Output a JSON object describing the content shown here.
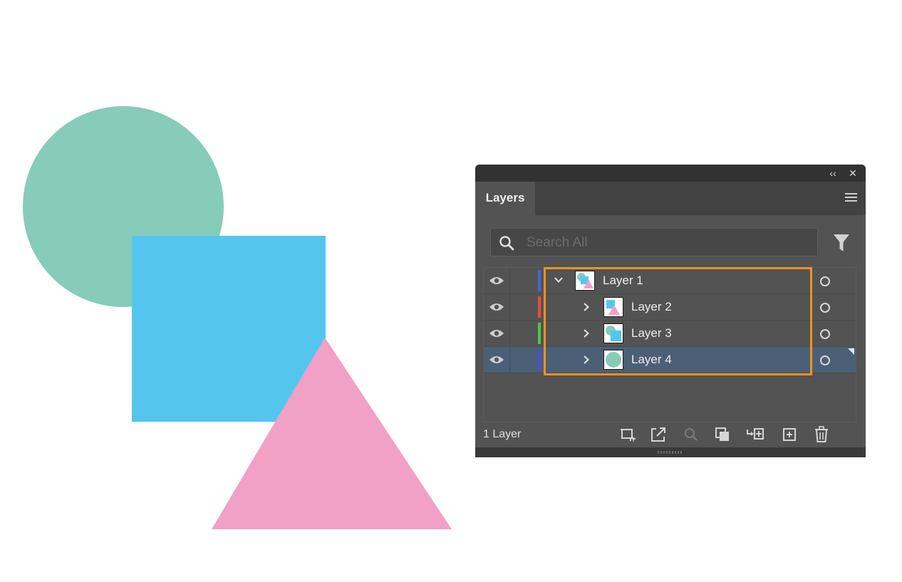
{
  "canvas": {
    "shapes": [
      {
        "kind": "circle",
        "name": "green-circle",
        "color": "#86ccb9"
      },
      {
        "kind": "square",
        "name": "blue-square",
        "color": "#54c6ee"
      },
      {
        "kind": "triangle",
        "name": "pink-triangle",
        "color": "#f1a0c6"
      }
    ]
  },
  "panel": {
    "collapse_glyph": "‹‹",
    "close_glyph": "✕",
    "tab_label": "Layers",
    "search": {
      "placeholder": "Search All",
      "value": ""
    },
    "layers": [
      {
        "label": "Layer 1",
        "color": "#4466dd",
        "expanded": true,
        "selected": false
      },
      {
        "label": "Layer 2",
        "color": "#e84d3d",
        "expanded": false,
        "selected": false
      },
      {
        "label": "Layer 3",
        "color": "#44cc44",
        "expanded": false,
        "selected": false
      },
      {
        "label": "Layer 4",
        "color": "#4f4fd6",
        "expanded": false,
        "selected": true
      }
    ],
    "footer": {
      "count_label": "1 Layer"
    },
    "highlight_color": "#f2931c"
  }
}
